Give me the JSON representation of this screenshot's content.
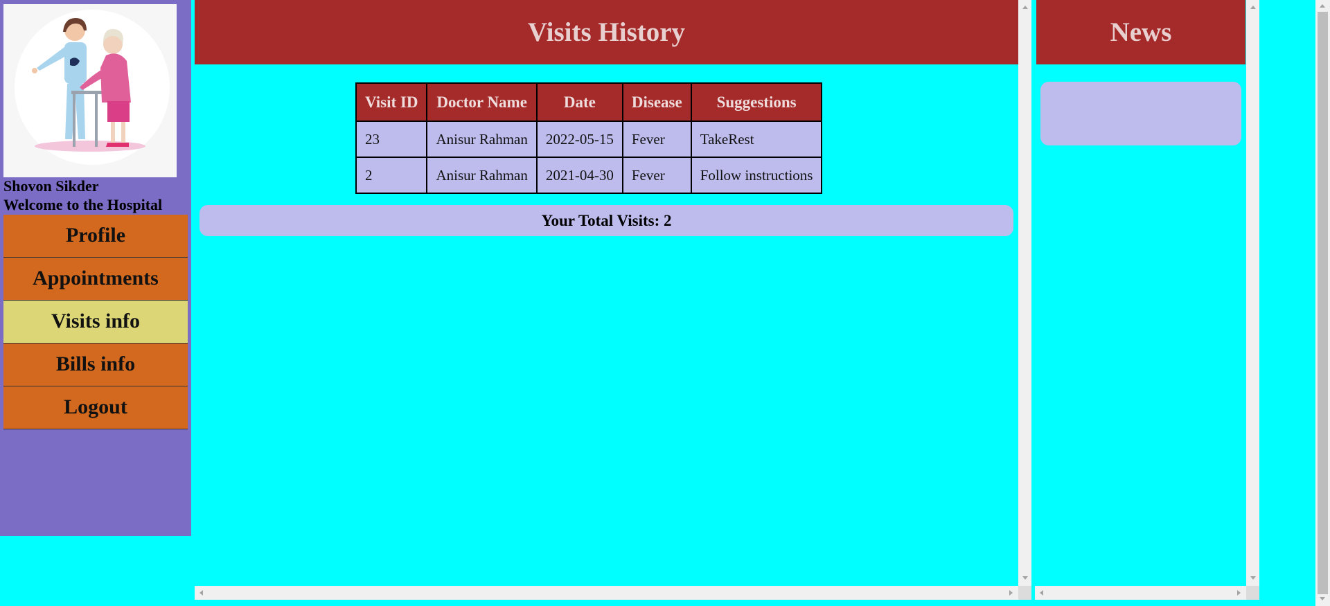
{
  "user": {
    "name": "Shovon Sikder",
    "welcome": "Welcome to the Hospital"
  },
  "nav": {
    "items": [
      {
        "label": "Profile",
        "active": false
      },
      {
        "label": "Appointments",
        "active": false
      },
      {
        "label": "Visits info",
        "active": true
      },
      {
        "label": "Bills info",
        "active": false
      },
      {
        "label": "Logout",
        "active": false
      }
    ]
  },
  "main": {
    "title": "Visits History",
    "table": {
      "headers": [
        "Visit ID",
        "Doctor Name",
        "Date",
        "Disease",
        "Suggestions"
      ],
      "rows": [
        [
          "23",
          "Anisur Rahman",
          "2022-05-15",
          "Fever",
          "TakeRest"
        ],
        [
          "2",
          "Anisur Rahman",
          "2021-04-30",
          "Fever",
          "Follow instructions"
        ]
      ]
    },
    "total_visits": "Your Total Visits: 2"
  },
  "news": {
    "title": "News"
  },
  "colors": {
    "sidebar": "#7b6dc6",
    "nav_button": "#d2691e",
    "nav_active": "#ddd676",
    "header": "#a52a2a",
    "page_bg": "#00ffff",
    "panel": "#bdbced"
  },
  "icons": {
    "avatar": "nurse-helping-elderly-woman-illustration"
  }
}
